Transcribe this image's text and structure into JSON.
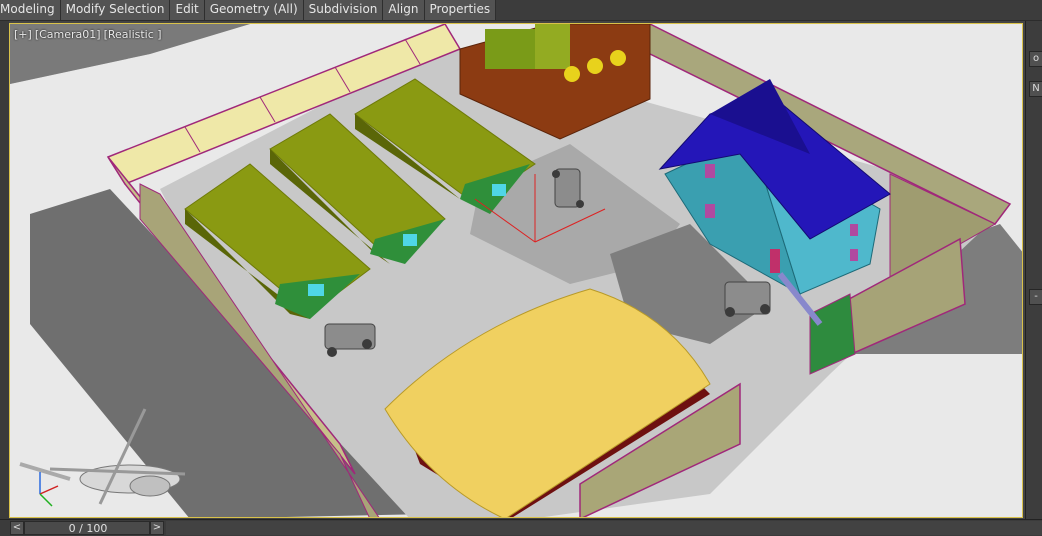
{
  "ribbon": {
    "tabs": [
      "Modeling",
      "Modify Selection",
      "Edit",
      "Geometry (All)",
      "Subdivision",
      "Align",
      "Properties"
    ]
  },
  "viewport": {
    "labels": [
      "[+]",
      "[Camera01]",
      "[Realistic ]"
    ],
    "border_color": "#d9c24a"
  },
  "right_panel": {
    "buttons": [
      "o",
      "N",
      "-"
    ]
  },
  "timeline": {
    "prev_label": "<",
    "next_label": ">",
    "frame_text": "0 / 100"
  },
  "colors": {
    "wall": "#efe8a8",
    "wall_outline": "#a0287a",
    "roof_green": "#8a9a12",
    "barrack_wall": "#2f8f3a",
    "house_wall": "#3a9fb0",
    "house_roof": "#2416b8",
    "hangar_roof": "#f0d060",
    "hangar_wall": "#6e1010",
    "ground": "#cfcfcf",
    "terrain": "#eeeeee"
  }
}
